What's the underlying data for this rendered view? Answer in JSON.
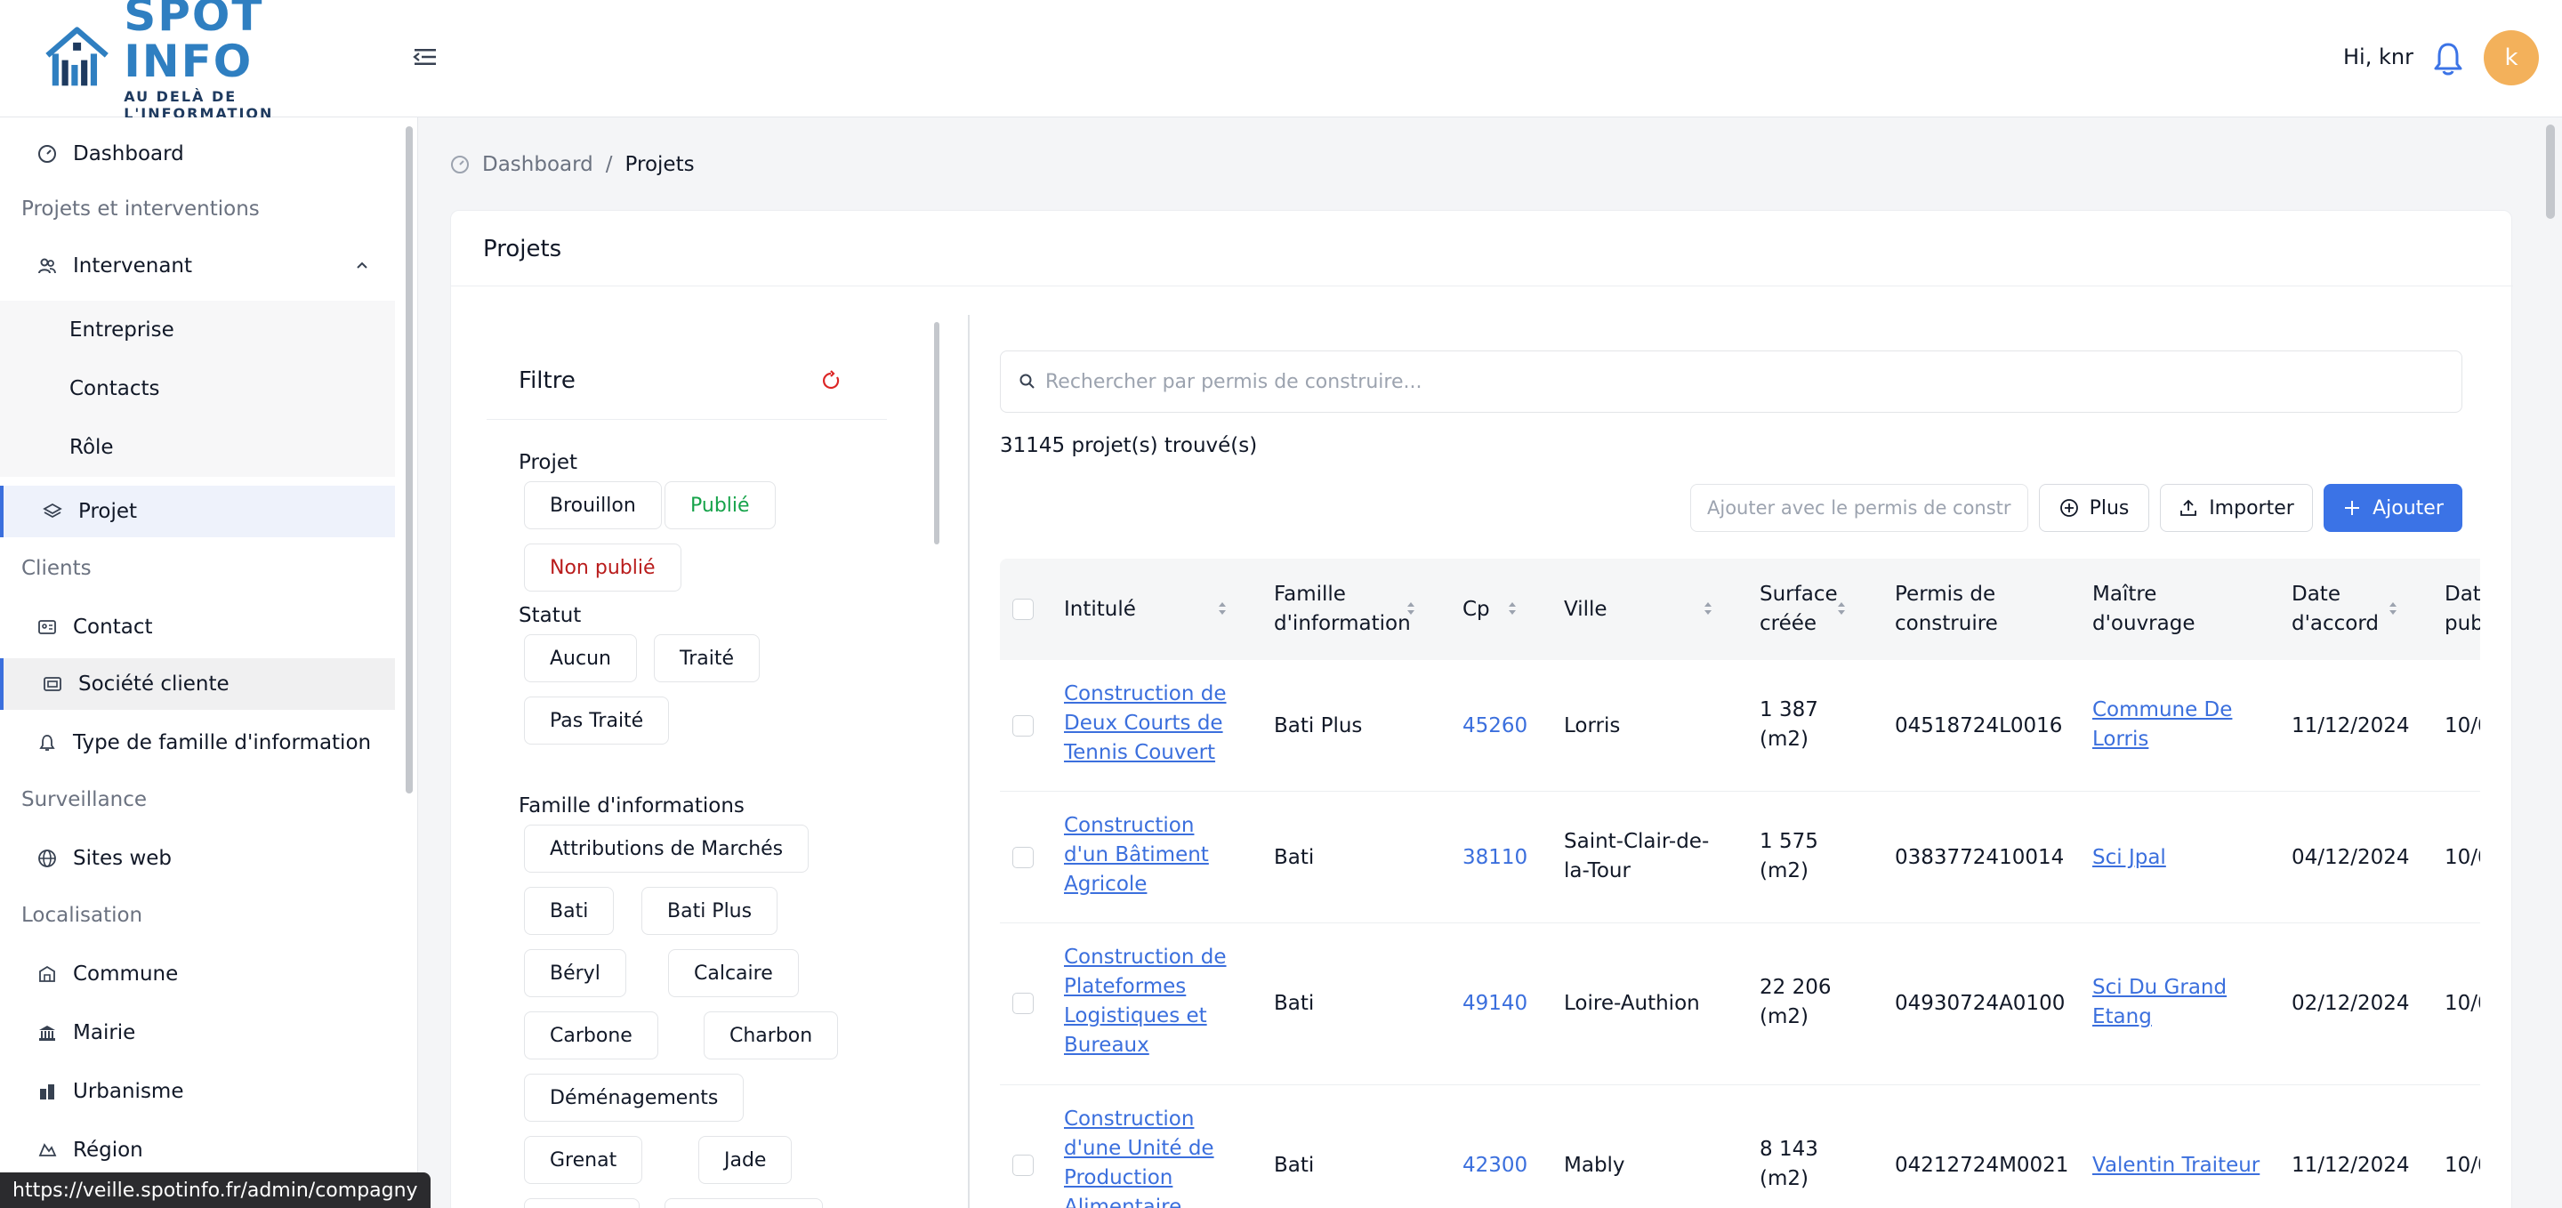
{
  "header": {
    "logo_title": "SPOT INFO",
    "logo_subtitle": "AU DELÀ DE L'INFORMATION",
    "greeting": "Hi, knr",
    "avatar_initial": "k"
  },
  "sidebar": {
    "dashboard": "Dashboard",
    "group_projets": "Projets et interventions",
    "intervenant": "Intervenant",
    "entreprise": "Entreprise",
    "contacts": "Contacts",
    "role": "Rôle",
    "projet": "Projet",
    "group_clients": "Clients",
    "contact": "Contact",
    "societe_cliente": "Société cliente",
    "type_famille": "Type de famille d'information",
    "group_surveillance": "Surveillance",
    "sites_web": "Sites web",
    "group_localisation": "Localisation",
    "commune": "Commune",
    "mairie": "Mairie",
    "urbanisme": "Urbanisme",
    "region": "Région"
  },
  "breadcrumb": {
    "home": "Dashboard",
    "separator": "/",
    "current": "Projets"
  },
  "card": {
    "title": "Projets"
  },
  "filter": {
    "title": "Filtre",
    "projet_label": "Projet",
    "projet_chips": [
      "Brouillon",
      "Publié",
      "Non publié"
    ],
    "statut_label": "Statut",
    "statut_chips": [
      "Aucun",
      "Traité",
      "Pas Traité"
    ],
    "famille_label": "Famille d'informations",
    "famille_chips": [
      "Attributions de Marchés",
      "Bati",
      "Bati Plus",
      "Béryl",
      "Calcaire",
      "Carbone",
      "Charbon",
      "Déménagements",
      "Grenat",
      "Jade"
    ]
  },
  "search": {
    "placeholder": "Rechercher par permis de construire..."
  },
  "results": {
    "count": "31145 projet(s) trouvé(s)"
  },
  "toolbar": {
    "permit_placeholder": "Ajouter avec le permis de constru...",
    "plus": "Plus",
    "importer": "Importer",
    "ajouter": "Ajouter"
  },
  "table": {
    "headers": {
      "intitule": "Intitulé",
      "famille_1": "Famille",
      "famille_2": "d'information",
      "cp": "Cp",
      "ville": "Ville",
      "surface_1": "Surface",
      "surface_2": "créée",
      "permis_1": "Permis de",
      "permis_2": "construire",
      "maitre_1": "Maître",
      "maitre_2": "d'ouvrage",
      "date_accord_1": "Date",
      "date_accord_2": "d'accord",
      "date_pub_1": "Date",
      "date_pub_2": "pub"
    },
    "rows": [
      {
        "intitule": [
          "Construction de",
          "Deux Courts de",
          "Tennis Couvert"
        ],
        "famille": "Bati Plus",
        "cp": "45260",
        "ville": [
          "Lorris"
        ],
        "surface": [
          "1 387",
          "(m2)"
        ],
        "permis": "04518724L0016",
        "maitre": [
          "Commune De",
          "Lorris"
        ],
        "date_accord": "11/12/2024",
        "date_pub": "10/0"
      },
      {
        "intitule": [
          "Construction",
          "d'un Bâtiment",
          "Agricole"
        ],
        "famille": "Bati",
        "cp": "38110",
        "ville": [
          "Saint-Clair-de-",
          "la-Tour"
        ],
        "surface": [
          "1 575",
          "(m2)"
        ],
        "permis": "0383772410014",
        "maitre": [
          "Sci Jpal"
        ],
        "date_accord": "04/12/2024",
        "date_pub": "10/0"
      },
      {
        "intitule": [
          "Construction de",
          "Plateformes",
          "Logistiques et",
          "Bureaux"
        ],
        "famille": "Bati",
        "cp": "49140",
        "ville": [
          "Loire-Authion"
        ],
        "surface": [
          "22 206",
          "(m2)"
        ],
        "permis": "04930724A0100",
        "maitre": [
          "Sci Du Grand",
          "Etang"
        ],
        "date_accord": "02/12/2024",
        "date_pub": "10/0"
      },
      {
        "intitule": [
          "Construction",
          "d'une Unité de",
          "Production",
          "Alimentaire"
        ],
        "famille": "Bati",
        "cp": "42300",
        "ville": [
          "Mably"
        ],
        "surface": [
          "8 143",
          "(m2)"
        ],
        "permis": "04212724M0021",
        "maitre": [
          "Valentin Traiteur"
        ],
        "date_accord": "11/12/2024",
        "date_pub": "10/0"
      }
    ]
  },
  "statusbar": {
    "url": "https://veille.spotinfo.fr/admin/compagny"
  },
  "colors": {
    "primary": "#3b73e6",
    "link": "#3b6fdd",
    "green": "#16a34a",
    "red": "#b91c1c",
    "avatar": "#f3b15b"
  }
}
